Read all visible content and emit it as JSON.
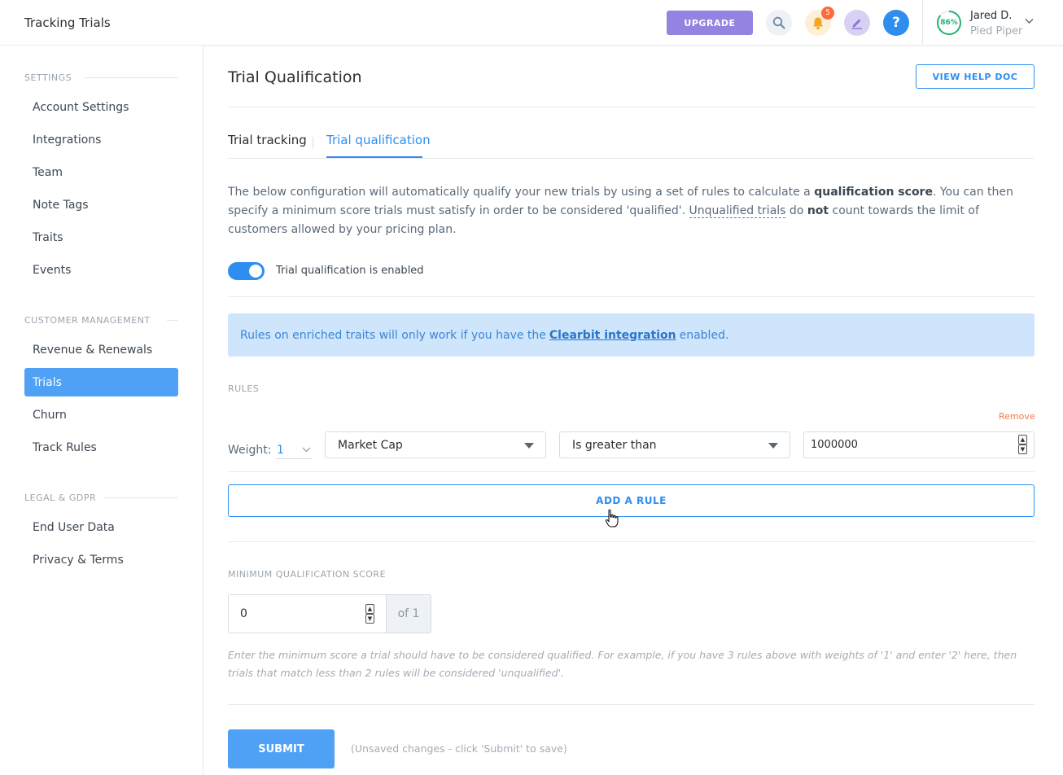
{
  "header": {
    "app_title": "Tracking Trials",
    "upgrade_label": "UPGRADE",
    "notification_count": "5",
    "help_label": "?",
    "user_name": "Jared D.",
    "user_org": "Pied Piper",
    "progress_label": "86%",
    "progress_value": 0.86,
    "accent_color": "#2e8ef0",
    "progress_color": "#22b573"
  },
  "sidebar": {
    "sections": [
      {
        "title": "SETTINGS",
        "items": [
          "Account Settings",
          "Integrations",
          "Team",
          "Note Tags",
          "Traits",
          "Events"
        ]
      },
      {
        "title": "CUSTOMER MANAGEMENT",
        "items": [
          "Revenue & Renewals",
          "Trials",
          "Churn",
          "Track Rules"
        ]
      },
      {
        "title": "LEGAL & GDPR",
        "items": [
          "End User Data",
          "Privacy & Terms"
        ]
      }
    ],
    "active_item": "Trials"
  },
  "main": {
    "page_title": "Trial Qualification",
    "help_doc_label": "VIEW HELP DOC",
    "tabs": [
      {
        "label": "Trial tracking",
        "active": false
      },
      {
        "label": "Trial qualification",
        "active": true
      }
    ],
    "description": {
      "part1": "The below configuration will automatically qualify your new trials by using a set of rules to calculate a ",
      "bold1": "qualification score",
      "part2": ". You can then specify a minimum score trials must satisfy in order to be considered 'qualified'. ",
      "link": "Unqualified trials",
      "part3": " do ",
      "bold2": "not",
      "part4": " count towards the limit of customers allowed by your pricing plan."
    },
    "toggle_label": "Trial qualification is enabled",
    "toggle_enabled": true,
    "info": {
      "before": "Rules on enriched traits will only work if you have the",
      "link": "Clearbit integration",
      "after": "enabled."
    },
    "rules_title": "RULES",
    "remove_label": "Remove",
    "rule": {
      "weight_label": "Weight:",
      "weight": "1",
      "trait": "Market Cap",
      "operator": "Is greater than",
      "value": "1000000"
    },
    "add_rule_label": "ADD A RULE",
    "min_score_title": "MINIMUM QUALIFICATION SCORE",
    "min_score_value": "0",
    "min_score_of": "of 1",
    "help_text": "Enter the minimum score a trial should have to be considered qualified. For example, if you have 3 rules above with weights of '1' and enter '2' here, then trials that match less than 2 rules will be considered 'unqualified'.",
    "submit_label": "SUBMIT",
    "unsaved_text": "(Unsaved changes - click 'Submit' to save)"
  }
}
